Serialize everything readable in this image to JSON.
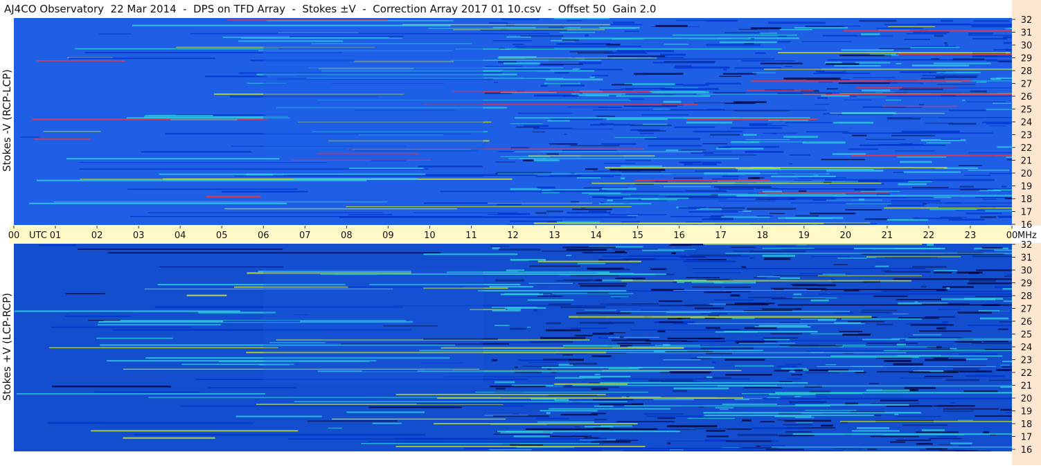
{
  "title": "AJ4CO Observatory  22 Mar 2014  -  DPS on TFD Array  -  Stokes ±V  -  Correction Array 2017 01 10.csv  -  Offset 50  Gain 2.0",
  "chart_data": [
    {
      "type": "heatmap",
      "panel": "top",
      "ylabel": "Stokes -V (RCP-LCP)",
      "x_ticks": [
        "00",
        "01",
        "02",
        "03",
        "04",
        "05",
        "06",
        "07",
        "08",
        "09",
        "10",
        "11",
        "12",
        "13",
        "14",
        "15",
        "16",
        "17",
        "18",
        "19",
        "20",
        "21",
        "22",
        "23",
        "00"
      ],
      "x_unit": "UTC",
      "y_ticks": [
        16,
        17,
        18,
        19,
        20,
        21,
        22,
        23,
        24,
        25,
        26,
        27,
        28,
        29,
        30,
        31,
        32
      ],
      "y_unit": "MHz",
      "ylim": [
        16,
        32
      ],
      "colormap": [
        "#000033",
        "#0033cc",
        "#1e5fe6",
        "#30d0e0",
        "#c8e020",
        "#ff3030"
      ]
    },
    {
      "type": "heatmap",
      "panel": "bottom",
      "ylabel": "Stokes +V (LCP-RCP)",
      "y_ticks": [
        16,
        17,
        18,
        19,
        20,
        21,
        22,
        23,
        24,
        25,
        26,
        27,
        28,
        29,
        30,
        31,
        32
      ],
      "y_unit": "MHz",
      "ylim": [
        16,
        32
      ],
      "colormap": [
        "#000033",
        "#0033cc",
        "#1e5fe6",
        "#30d0e0",
        "#c8e020",
        "#ff3030"
      ]
    }
  ],
  "time_axis": {
    "labels": [
      "00",
      "01",
      "02",
      "03",
      "04",
      "05",
      "06",
      "07",
      "08",
      "09",
      "10",
      "11",
      "12",
      "13",
      "14",
      "15",
      "16",
      "17",
      "18",
      "19",
      "20",
      "21",
      "22",
      "23",
      "00"
    ],
    "utc_label": "UTC",
    "mhz_label": "MHz"
  },
  "colors": {
    "background": "#ffffff",
    "timebar": "#fff9c8",
    "freqbar": "#fde6cf",
    "base_blue": "#1e5fe6"
  }
}
